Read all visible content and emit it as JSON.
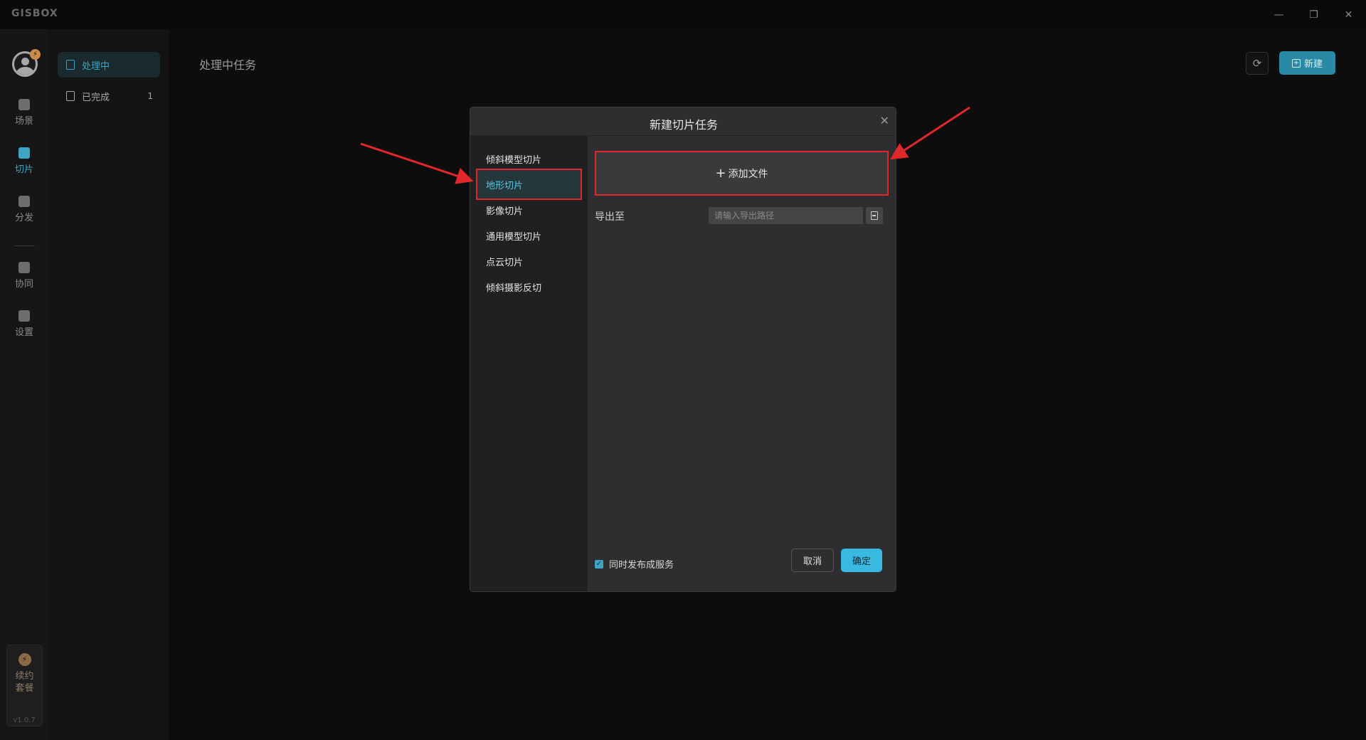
{
  "app": {
    "logo": "GISBOX",
    "version": "v1.0.7"
  },
  "window_controls": {
    "minimize": "—",
    "restore": "❐",
    "close": "✕"
  },
  "rail": {
    "items": [
      {
        "label": "场景",
        "icon": "scene-icon"
      },
      {
        "label": "切片",
        "icon": "slice-icon",
        "active": true
      },
      {
        "label": "分发",
        "icon": "distribute-icon"
      },
      {
        "label": "协同",
        "icon": "collab-icon"
      },
      {
        "label": "设置",
        "icon": "settings-icon"
      }
    ],
    "renew_label": "续约套餐",
    "avatar_badge": "⚡",
    "renew_icon": "⚡"
  },
  "subnav": {
    "items": [
      {
        "label": "处理中",
        "active": true
      },
      {
        "label": "已完成",
        "count": "1"
      }
    ]
  },
  "main": {
    "title": "处理中任务",
    "refresh_icon": "⟳",
    "new_button": "新建",
    "new_icon": "+"
  },
  "dialog": {
    "title": "新建切片任务",
    "close_icon": "✕",
    "types": [
      "倾斜模型切片",
      "地形切片",
      "影像切片",
      "通用模型切片",
      "点云切片",
      "倾斜摄影反切"
    ],
    "selected_type": "地形切片",
    "add_file_label": "添加文件",
    "add_file_icon": "+",
    "export_label": "导出至",
    "export_value": "",
    "export_placeholder": "请输入导出路径",
    "publish_label": "同时发布成服务",
    "publish_checked": true,
    "cancel_label": "取消",
    "ok_label": "确定"
  },
  "colors": {
    "accent": "#3fa4c4",
    "highlight_box": "#e0272c",
    "ok_button": "#39b8e0"
  }
}
